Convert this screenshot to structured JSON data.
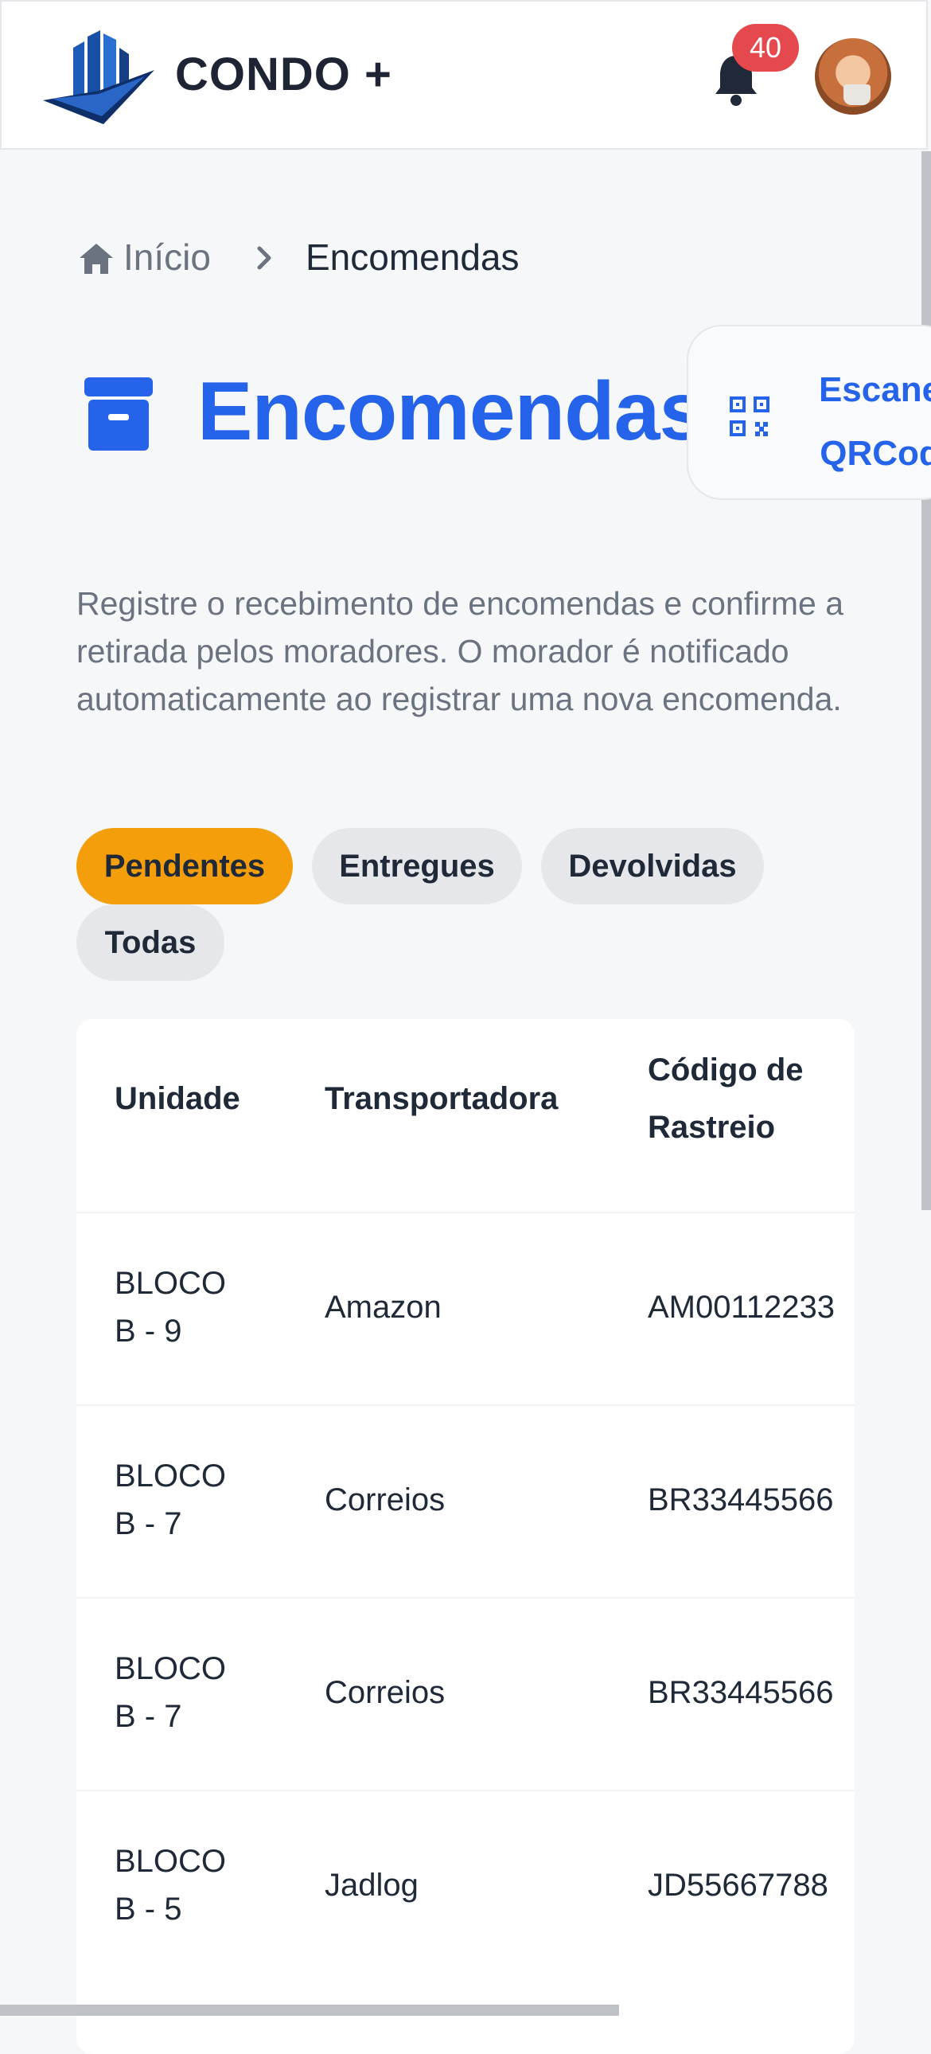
{
  "header": {
    "brand": "CONDO +",
    "notifications_count": "40"
  },
  "breadcrumb": {
    "home": "Início",
    "current": "Encomendas"
  },
  "page": {
    "title": "Encomendas",
    "scan_button": "Escanear QRCode",
    "scan_line1": "Escane",
    "scan_line2": "QRCod",
    "description": "Registre o recebimento de encomendas e confirme a retirada pelos moradores. O morador é notificado automaticamente ao registrar uma nova encomenda."
  },
  "filters": {
    "active": "Pendentes",
    "items": [
      "Pendentes",
      "Entregues",
      "Devolvidas",
      "Todas"
    ]
  },
  "table": {
    "headers": {
      "unit": "Unidade",
      "carrier": "Transportadora",
      "tracking_1": "Código de",
      "tracking_2": "Rastreio"
    },
    "rows": [
      {
        "unit_1": "BLOCO",
        "unit_2": "B - 9",
        "carrier": "Amazon",
        "tracking": "AM00112233"
      },
      {
        "unit_1": "BLOCO",
        "unit_2": "B - 7",
        "carrier": "Correios",
        "tracking": "BR33445566"
      },
      {
        "unit_1": "BLOCO",
        "unit_2": "B - 7",
        "carrier": "Correios",
        "tracking": "BR33445566"
      },
      {
        "unit_1": "BLOCO",
        "unit_2": "B - 5",
        "carrier": "Jadlog",
        "tracking": "JD55667788"
      }
    ]
  },
  "colors": {
    "primary": "#2563eb",
    "active_chip": "#f59e0b",
    "badge": "#e5484d"
  }
}
